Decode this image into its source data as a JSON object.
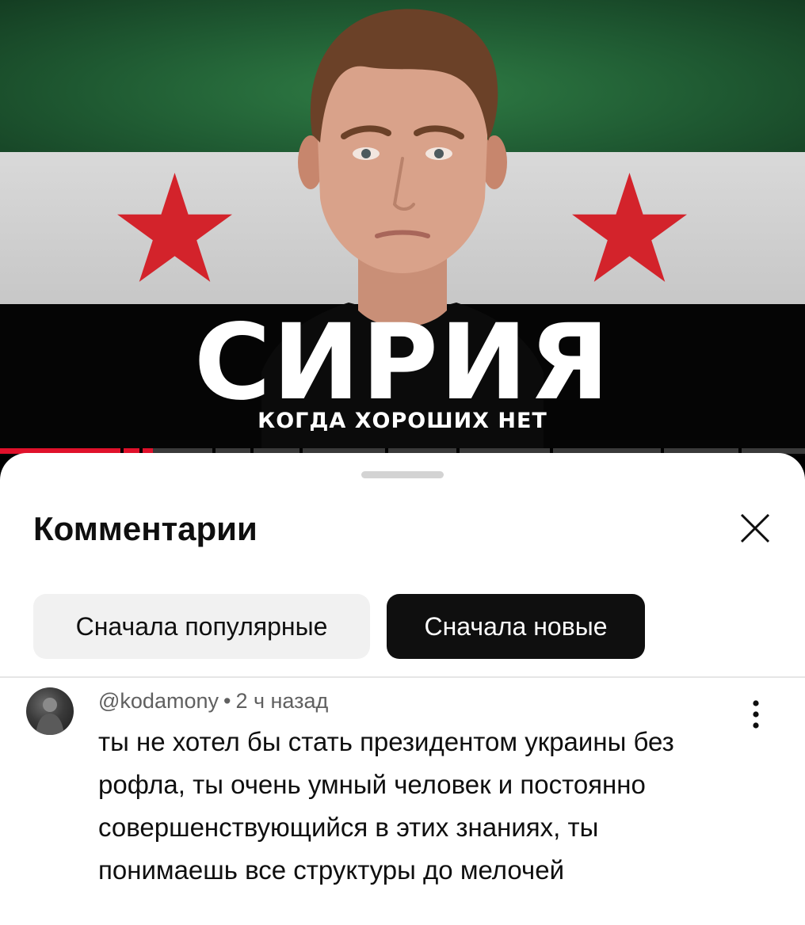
{
  "video": {
    "title_main": "СИРИЯ",
    "title_sub": "КОГДА ХОРОШИХ НЕТ",
    "progress_fraction": 0.19,
    "colors": {
      "green": "#1f5a32",
      "white": "#d0d0d0",
      "black": "#050505",
      "star": "#d3232b",
      "progress": "#e0112b"
    }
  },
  "comments_panel": {
    "title": "Комментарии",
    "close_icon": "close-icon",
    "sort_chips": [
      {
        "label": "Сначала популярные",
        "selected": false
      },
      {
        "label": "Сначала новые",
        "selected": true
      }
    ]
  },
  "comments": [
    {
      "author": "@kodamony",
      "separator": "•",
      "time": "2 ч назад",
      "text": "ты не хотел бы стать президентом украины без рофла, ты очень умный человек и постоянно совершенствующийся в этих знаниях, ты понимаешь все структуры до мелочей",
      "menu_icon": "more-vert-icon"
    }
  ]
}
